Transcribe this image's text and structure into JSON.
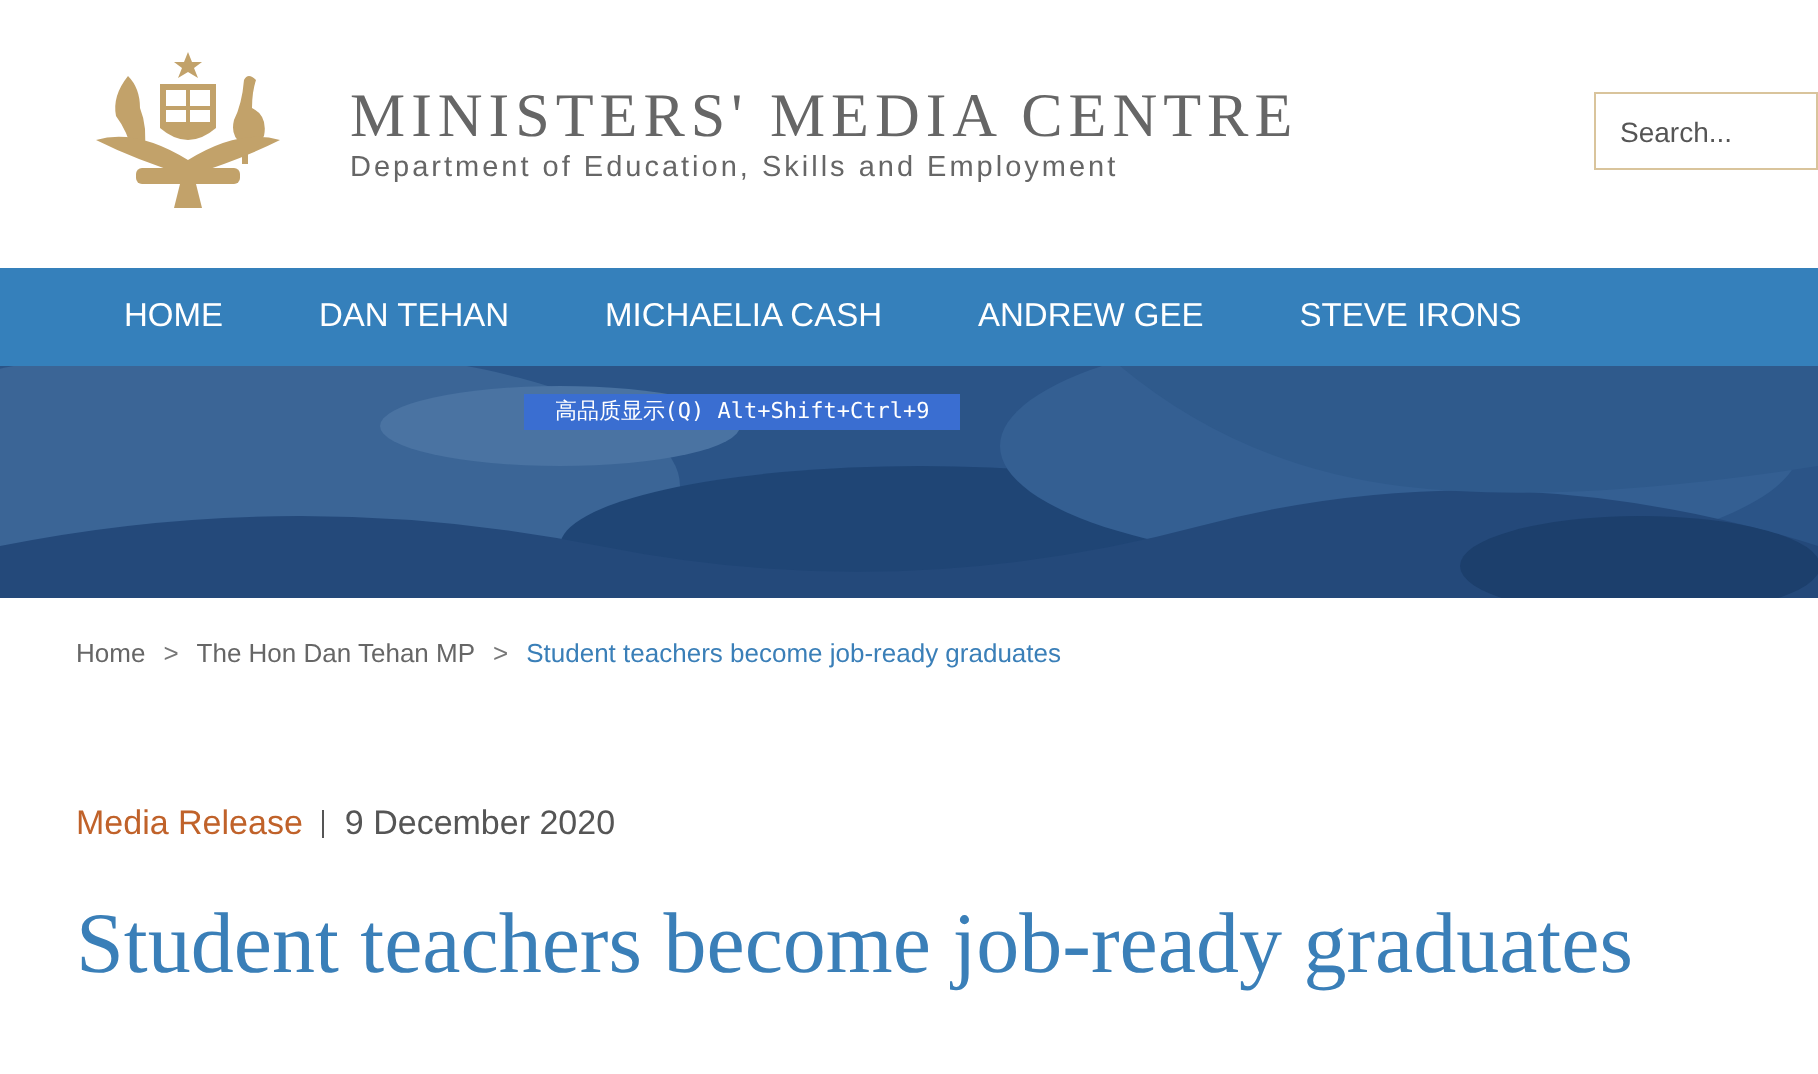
{
  "header": {
    "title": "MINISTERS' MEDIA CENTRE",
    "subtitle": "Department of Education, Skills and Employment",
    "search": {
      "placeholder": "Search..."
    }
  },
  "nav": {
    "items": [
      {
        "label": "HOME"
      },
      {
        "label": "DAN TEHAN"
      },
      {
        "label": "MICHAELIA CASH"
      },
      {
        "label": "ANDREW GEE"
      },
      {
        "label": "STEVE IRONS"
      }
    ]
  },
  "banner": {
    "kind": "picture",
    "tooltip": "高品质显示(Q) Alt+Shift+Ctrl+9"
  },
  "breadcrumb": [
    {
      "label": "Home",
      "current": false
    },
    {
      "label": "The Hon Dan Tehan MP",
      "current": false
    },
    {
      "label": "Student teachers become job-ready graduates",
      "current": true
    }
  ],
  "breadcrumb_separators": [
    ">",
    ">"
  ],
  "article": {
    "type": "Media Release",
    "date": "9 December 2020",
    "title": "Student teachers become job-ready graduates"
  }
}
